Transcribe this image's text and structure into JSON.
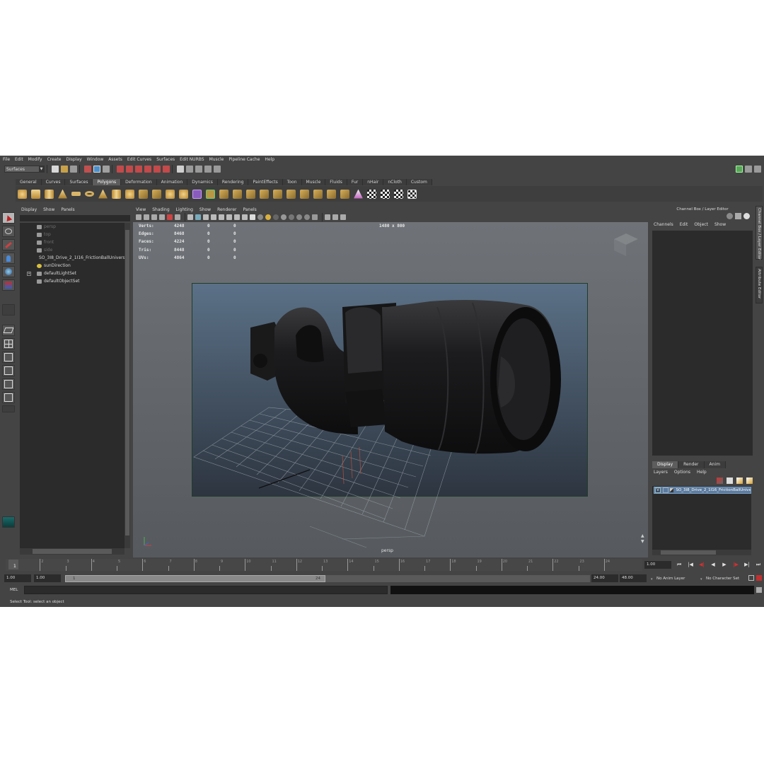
{
  "menubar": [
    "File",
    "Edit",
    "Modify",
    "Create",
    "Display",
    "Window",
    "Assets",
    "Edit Curves",
    "Surfaces",
    "Edit NURBS",
    "Muscle",
    "Pipeline Cache",
    "Help"
  ],
  "statusline": {
    "mode": "Surfaces"
  },
  "shelf": {
    "tabs": [
      "General",
      "Curves",
      "Surfaces",
      "Polygons",
      "Deformation",
      "Animation",
      "Dynamics",
      "Rendering",
      "PaintEffects",
      "Toon",
      "Muscle",
      "Fluids",
      "Fur",
      "nHair",
      "nCloth",
      "Custom"
    ],
    "active_tab": "Polygons"
  },
  "outliner": {
    "menu": [
      "Display",
      "Show",
      "Panels"
    ],
    "items": [
      {
        "label": "persp",
        "dim": true
      },
      {
        "label": "top",
        "dim": true
      },
      {
        "label": "front",
        "dim": true
      },
      {
        "label": "side",
        "dim": true
      },
      {
        "label": "SO_3I8_Drive_2_1I16_FrictionBallUnivers",
        "dim": false
      },
      {
        "label": "sunDirection",
        "dim": false
      },
      {
        "label": "defaultLightSet",
        "dim": false
      },
      {
        "label": "defaultObjectSet",
        "dim": false
      }
    ]
  },
  "viewport": {
    "menu": [
      "View",
      "Shading",
      "Lighting",
      "Show",
      "Renderer",
      "Panels"
    ],
    "hud": [
      {
        "label": "Verts:",
        "values": [
          "4248",
          "0",
          "0"
        ]
      },
      {
        "label": "Edges:",
        "values": [
          "8468",
          "0",
          "0"
        ]
      },
      {
        "label": "Faces:",
        "values": [
          "4224",
          "0",
          "0"
        ]
      },
      {
        "label": "Tris:",
        "values": [
          "8448",
          "0",
          "0"
        ]
      },
      {
        "label": "UVs:",
        "values": [
          "4864",
          "0",
          "0"
        ]
      }
    ],
    "resolution": "1480 x 800",
    "camera": "persp"
  },
  "channelbox": {
    "title": "Channel Box / Layer Editor",
    "menu": [
      "Channels",
      "Edit",
      "Object",
      "Show"
    ],
    "layer_tabs": [
      "Display",
      "Render",
      "Anim"
    ],
    "layer_menu": [
      "Layers",
      "Options",
      "Help"
    ],
    "layer": {
      "visible": "V",
      "name": "SO_3I8_Drive_2_1I16_FrictionBallUniver"
    }
  },
  "side_tabs": [
    "Channel Box / Layer Editor",
    "Attribute Editor"
  ],
  "timeline": {
    "labels": [
      "2",
      "4",
      "6",
      "8",
      "10",
      "12",
      "14",
      "16",
      "18",
      "20",
      "22",
      "24",
      "3",
      "5",
      "7",
      "9",
      "11",
      "13",
      "15",
      "17",
      "19",
      "21",
      "23"
    ],
    "ticks": [
      "2",
      "3",
      "4",
      "5",
      "6",
      "7",
      "8",
      "9",
      "10",
      "11",
      "12",
      "13",
      "14",
      "15",
      "16",
      "17",
      "18",
      "19",
      "20",
      "21",
      "22",
      "23",
      "24"
    ],
    "current_frame": "1",
    "frame_field": "1.00"
  },
  "range": {
    "start": "1.00",
    "start2": "1.00",
    "thumb_start": "1",
    "thumb_end": "24",
    "end": "24.00",
    "end2": "48.00",
    "anim_layer": "No Anim Layer",
    "character_set": "No Character Set"
  },
  "cmdline": {
    "label": "MEL"
  },
  "helpline": {
    "text": "Select Tool: select an object"
  }
}
